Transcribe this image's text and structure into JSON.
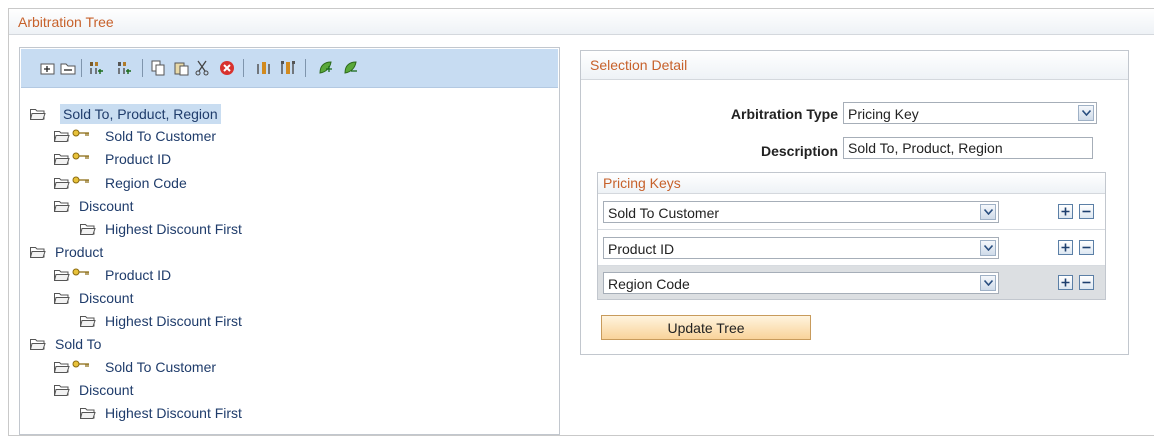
{
  "frame": {
    "title": "Arbitration Tree"
  },
  "toolbar": {
    "icons": [
      "insert-child-icon",
      "insert-sibling-icon",
      "move-up-icon",
      "move-down-icon",
      "copy-icon",
      "paste-icon",
      "cut-icon",
      "delete-icon",
      "promote-icon",
      "demote-icon",
      "expand-icon",
      "collapse-icon"
    ]
  },
  "tree": {
    "nodes": [
      {
        "label": "Sold To, Product, Region",
        "level": 0,
        "type": "folder",
        "selected": true
      },
      {
        "label": "Sold To Customer",
        "level": 1,
        "type": "key"
      },
      {
        "label": "Product ID",
        "level": 1,
        "type": "key"
      },
      {
        "label": "Region Code",
        "level": 1,
        "type": "key"
      },
      {
        "label": "Discount",
        "level": 1,
        "type": "folder"
      },
      {
        "label": "Highest Discount First",
        "level": 2,
        "type": "folder"
      },
      {
        "label": "Product",
        "level": 0,
        "type": "folder"
      },
      {
        "label": "Product ID",
        "level": 1,
        "type": "key"
      },
      {
        "label": "Discount",
        "level": 1,
        "type": "folder"
      },
      {
        "label": "Highest Discount First",
        "level": 2,
        "type": "folder"
      },
      {
        "label": "Sold To",
        "level": 0,
        "type": "folder"
      },
      {
        "label": "Sold To Customer",
        "level": 1,
        "type": "key"
      },
      {
        "label": "Discount",
        "level": 1,
        "type": "folder"
      },
      {
        "label": "Highest Discount First",
        "level": 2,
        "type": "folder"
      }
    ]
  },
  "detail": {
    "title": "Selection Detail",
    "arbitration_type_label": "Arbitration Type",
    "arbitration_type_value": "Pricing Key",
    "description_label": "Description",
    "description_value": "Sold To, Product, Region",
    "pricing_keys": {
      "title": "Pricing Keys",
      "rows": [
        {
          "value": "Sold To Customer"
        },
        {
          "value": "Product ID"
        },
        {
          "value": "Region Code"
        }
      ]
    },
    "update_button": "Update Tree"
  },
  "colors": {
    "accent": "#c7612b",
    "link": "#1f3c6b",
    "toolbar_bg": "#c7dcf2",
    "button_bg": "#f9d39a"
  }
}
